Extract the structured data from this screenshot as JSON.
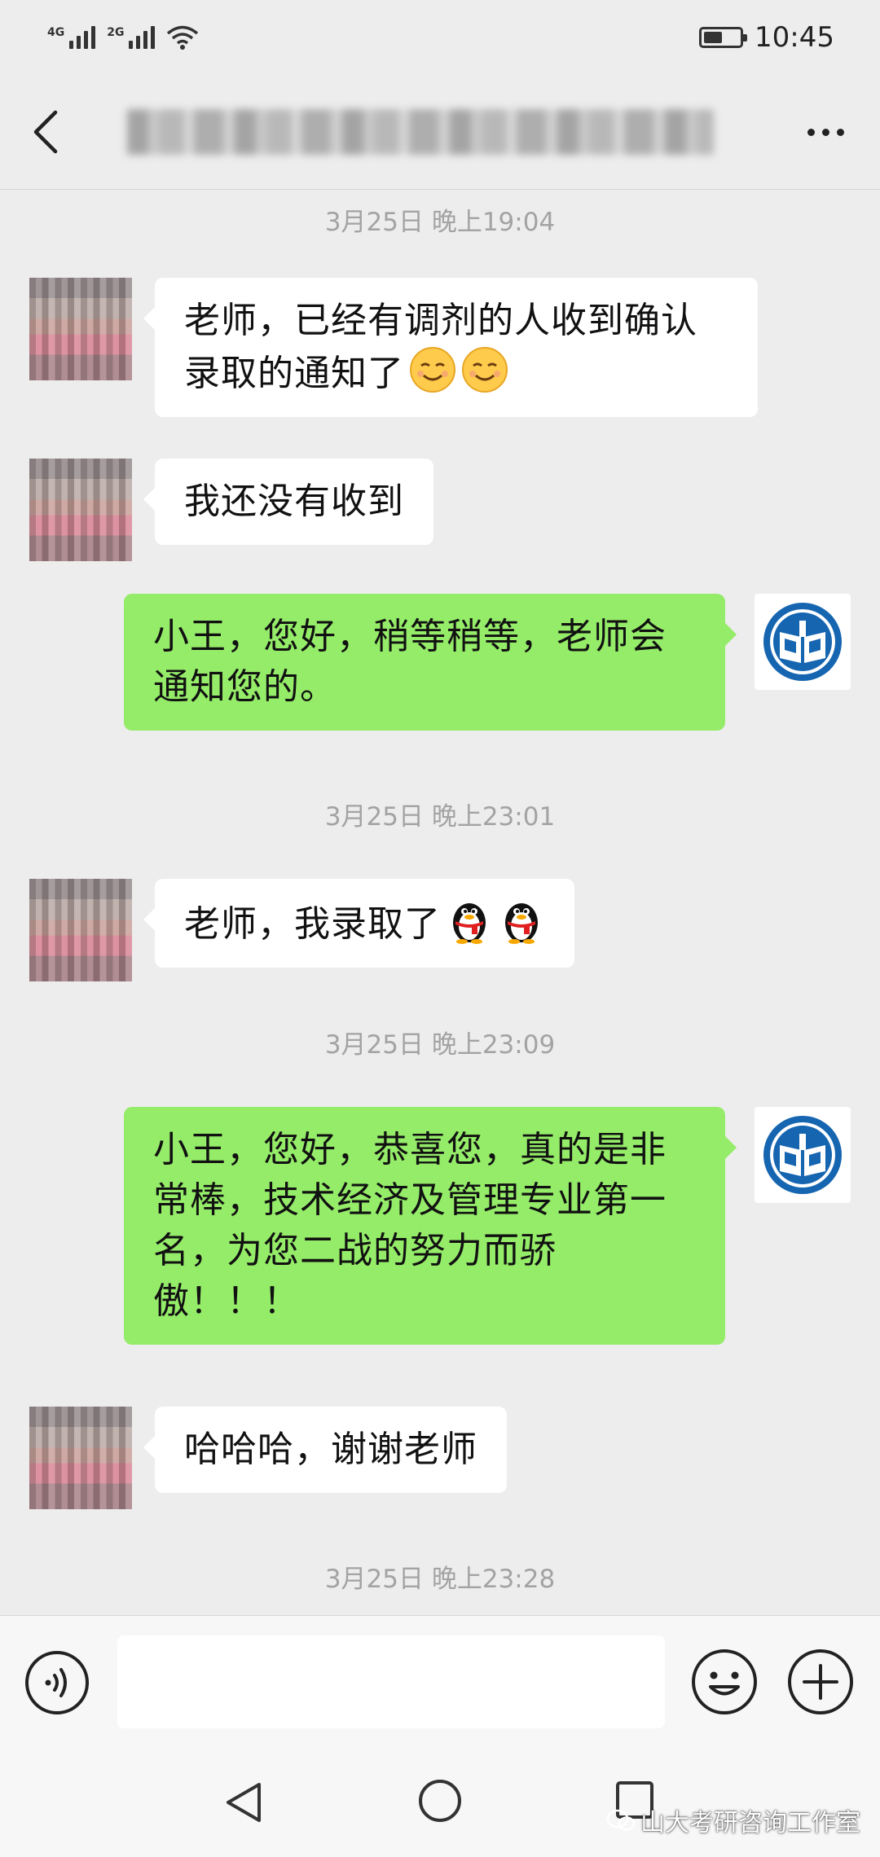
{
  "status_bar": {
    "signal_1_label": "4G",
    "signal_2_label": "2G",
    "time": "10:45",
    "battery_icon": "battery-icon",
    "wifi_icon": "wifi-icon"
  },
  "header": {
    "back_icon": "chevron-left-icon",
    "title": "",
    "more_icon": "more-horizontal-icon"
  },
  "messages": [
    {
      "kind": "timestamp",
      "text": "3月25日 晚上19:04"
    },
    {
      "kind": "in",
      "text": "老师，已经有调剂的人收到确认录取的通知了",
      "emoji": [
        "smile-emoji",
        "smile-emoji"
      ]
    },
    {
      "kind": "in",
      "text": "我还没有收到"
    },
    {
      "kind": "out",
      "text": "小王，您好，稍等稍等，老师会通知您的。"
    },
    {
      "kind": "timestamp",
      "text": "3月25日 晚上23:01"
    },
    {
      "kind": "in",
      "text": "老师，我录取了",
      "emoji": [
        "penguin-emoji",
        "penguin-emoji"
      ]
    },
    {
      "kind": "timestamp",
      "text": "3月25日 晚上23:09"
    },
    {
      "kind": "out",
      "text": "小王，您好，恭喜您，真的是非常棒，技术经济及管理专业第一名，为您二战的努力而骄傲！！！"
    },
    {
      "kind": "in",
      "text": "哈哈哈，谢谢老师"
    },
    {
      "kind": "timestamp",
      "text": "3月25日 晚上23:28"
    }
  ],
  "input_bar": {
    "voice_icon": "voice-icon",
    "input_value": "",
    "emoji_icon": "smiley-icon",
    "plus_icon": "plus-icon"
  },
  "system_nav": {
    "back_icon": "triangle-back-icon",
    "home_icon": "circle-home-icon",
    "recent_icon": "square-recent-icon"
  },
  "watermark": "山大考研咨询工作室",
  "colors": {
    "chat_background": "#ededed",
    "incoming_bubble": "#ffffff",
    "outgoing_bubble": "#95ec69",
    "timestamp_text": "#a3a3a3",
    "logo_blue": "#1565b0"
  }
}
